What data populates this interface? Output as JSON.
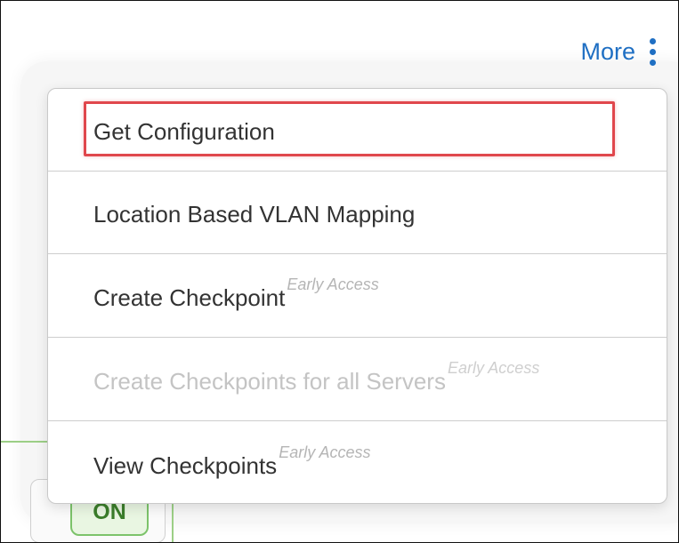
{
  "header": {
    "more_label": "More",
    "kebab_icon": "more-vertical-icon"
  },
  "menu": {
    "items": [
      {
        "label": "Get Configuration",
        "badge": "",
        "disabled": false,
        "highlighted": true
      },
      {
        "label": "Location Based VLAN Mapping",
        "badge": "",
        "disabled": false,
        "highlighted": false
      },
      {
        "label": "Create Checkpoint",
        "badge": "Early Access",
        "disabled": false,
        "highlighted": false
      },
      {
        "label": "Create Checkpoints for all Servers",
        "badge": "Early Access",
        "disabled": true,
        "highlighted": false
      },
      {
        "label": "View Checkpoints",
        "badge": "Early Access",
        "disabled": false,
        "highlighted": false
      }
    ]
  },
  "background": {
    "toggle_label": "ON"
  },
  "colors": {
    "link_blue": "#1f6fc3",
    "highlight_red": "#e0474c",
    "toggle_green": "#7cc36a"
  }
}
